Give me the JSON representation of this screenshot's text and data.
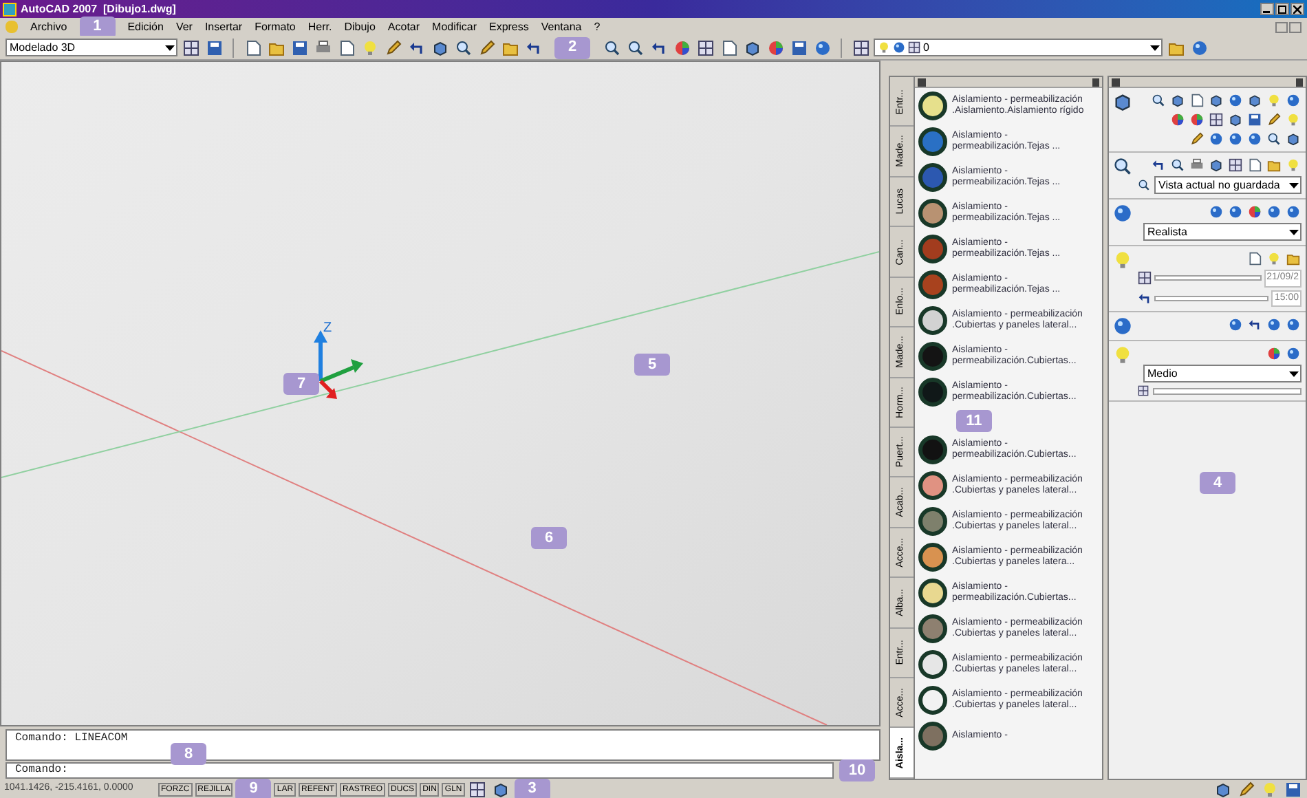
{
  "window": {
    "title": "AutoCAD 2007  [Dibujo1.dwg]"
  },
  "menu": {
    "items": [
      "Archivo",
      "Edición",
      "Ver",
      "Insertar",
      "Formato",
      "Herr.",
      "Dibujo",
      "Acotar",
      "Modificar",
      "Express",
      "Ventana",
      "?"
    ],
    "callout": "1"
  },
  "toolbar": {
    "workspace": "Modelado 3D",
    "layer": "0",
    "callout": "2"
  },
  "viewport": {
    "ucs_label": "Z",
    "callouts": [
      "5",
      "6",
      "7"
    ]
  },
  "palette": {
    "callout": "11",
    "tabs": [
      {
        "label": "Entr...",
        "selected": false
      },
      {
        "label": "Made...",
        "selected": false
      },
      {
        "label": "Lucas",
        "selected": false
      },
      {
        "label": "Can...",
        "selected": false
      },
      {
        "label": "Enlo...",
        "selected": false
      },
      {
        "label": "Made...",
        "selected": false
      },
      {
        "label": "Horm...",
        "selected": false
      },
      {
        "label": "Puert...",
        "selected": false
      },
      {
        "label": "Acab...",
        "selected": false
      },
      {
        "label": "Acce...",
        "selected": false
      },
      {
        "label": "Alba...",
        "selected": false
      },
      {
        "label": "Entr...",
        "selected": false
      },
      {
        "label": "Acce...",
        "selected": false
      },
      {
        "label": "Aisla...",
        "selected": true
      }
    ],
    "items": [
      {
        "label": "Aislamiento - permeabilización .Aislamiento.Aislamiento rígido",
        "color": "#e6e08c"
      },
      {
        "label": "Aislamiento - permeabilización.Tejas ...",
        "color": "#2a70c4"
      },
      {
        "label": "Aislamiento - permeabilización.Tejas ...",
        "color": "#2c58b0"
      },
      {
        "label": "Aislamiento - permeabilización.Tejas ...",
        "color": "#b89272"
      },
      {
        "label": "Aislamiento - permeabilización.Tejas ...",
        "color": "#a23c1e"
      },
      {
        "label": "Aislamiento - permeabilización.Tejas ...",
        "color": "#a8421e"
      },
      {
        "label": "Aislamiento - permeabilización .Cubiertas y paneles lateral...",
        "color": "#d2d2d2"
      },
      {
        "label": "Aislamiento - permeabilización.Cubiertas...",
        "color": "#141414"
      },
      {
        "label": "Aislamiento - permeabilización.Cubiertas...",
        "color": "#101818"
      },
      {
        "label": "Aislamiento - permeabilización.Cubiertas...",
        "color": "#121212"
      },
      {
        "label": "Aislamiento - permeabilización .Cubiertas y paneles lateral...",
        "color": "#e09282"
      },
      {
        "label": "Aislamiento - permeabilización .Cubiertas y paneles lateral...",
        "color": "#7e806c"
      },
      {
        "label": "Aislamiento - permeabilización .Cubiertas y paneles latera...",
        "color": "#d89250"
      },
      {
        "label": "Aislamiento - permeabilización.Cubiertas...",
        "color": "#e8d890"
      },
      {
        "label": "Aislamiento - permeabilización .Cubiertas y paneles lateral...",
        "color": "#8e8070"
      },
      {
        "label": "Aislamiento - permeabilización .Cubiertas y paneles lateral...",
        "color": "#e6e6e6"
      },
      {
        "label": "Aislamiento - permeabilización .Cubiertas y paneles lateral...",
        "color": "#f2f2f2"
      },
      {
        "label": "Aislamiento -",
        "color": "#7e7060"
      }
    ]
  },
  "dashboard": {
    "view": "Vista actual no guardada",
    "visual_style": "Realista",
    "date": "21/09/2",
    "time": "15:00",
    "quality": "Medio",
    "callout": "4"
  },
  "command_line": {
    "history": "Comando: LINEACOM",
    "prompt": "Comando:",
    "callouts": [
      "8",
      "10"
    ]
  },
  "status_bar": {
    "coordinates": "1041.1426, -215.4161, 0.0000",
    "toggles": [
      "FORZC",
      "REJILLA",
      "LAR",
      "REFENT",
      "RASTREO",
      "DUCS",
      "DIN",
      "GLN"
    ],
    "callouts": [
      "9",
      "3"
    ]
  }
}
